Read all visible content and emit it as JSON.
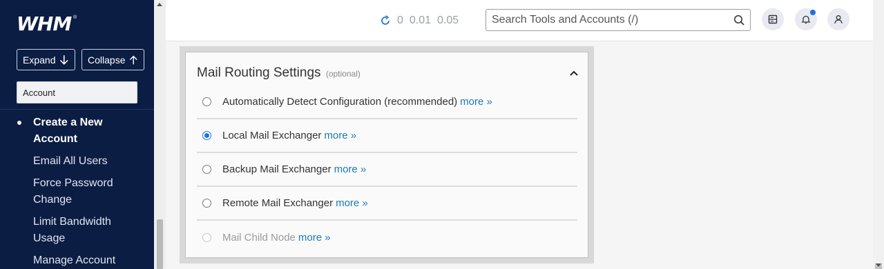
{
  "sidebar": {
    "logo": "WHM",
    "logo_mark": "®",
    "expand_label": "Expand",
    "collapse_label": "Collapse",
    "search_value": "Account",
    "items": [
      {
        "label": "Create a New Account",
        "active": true
      },
      {
        "label": "Email All Users"
      },
      {
        "label": "Force Password Change"
      },
      {
        "label": "Limit Bandwidth Usage"
      },
      {
        "label": "Manage Account"
      }
    ]
  },
  "header": {
    "load_averages": [
      "0",
      "0.01",
      "0.05"
    ],
    "search_placeholder": "Search Tools and Accounts (/)",
    "icons": [
      "server-icon",
      "bell-icon",
      "user-icon"
    ],
    "notification_dot_color": "#1f6fe0"
  },
  "panel": {
    "title": "Mail Routing Settings",
    "optional_label": "(optional)",
    "options": [
      {
        "label": "Automatically Detect Configuration (recommended)",
        "more": "more »",
        "checked": false,
        "disabled": false
      },
      {
        "label": "Local Mail Exchanger",
        "more": "more »",
        "checked": true,
        "disabled": false
      },
      {
        "label": "Backup Mail Exchanger",
        "more": "more »",
        "checked": false,
        "disabled": false
      },
      {
        "label": "Remote Mail Exchanger",
        "more": "more »",
        "checked": false,
        "disabled": false
      },
      {
        "label": "Mail Child Node",
        "more": "more »",
        "checked": false,
        "disabled": true
      }
    ]
  },
  "colors": {
    "sidebar_bg": "#0c1d44",
    "link": "#1a7ab8",
    "radio_checked": "#1a73e8"
  }
}
